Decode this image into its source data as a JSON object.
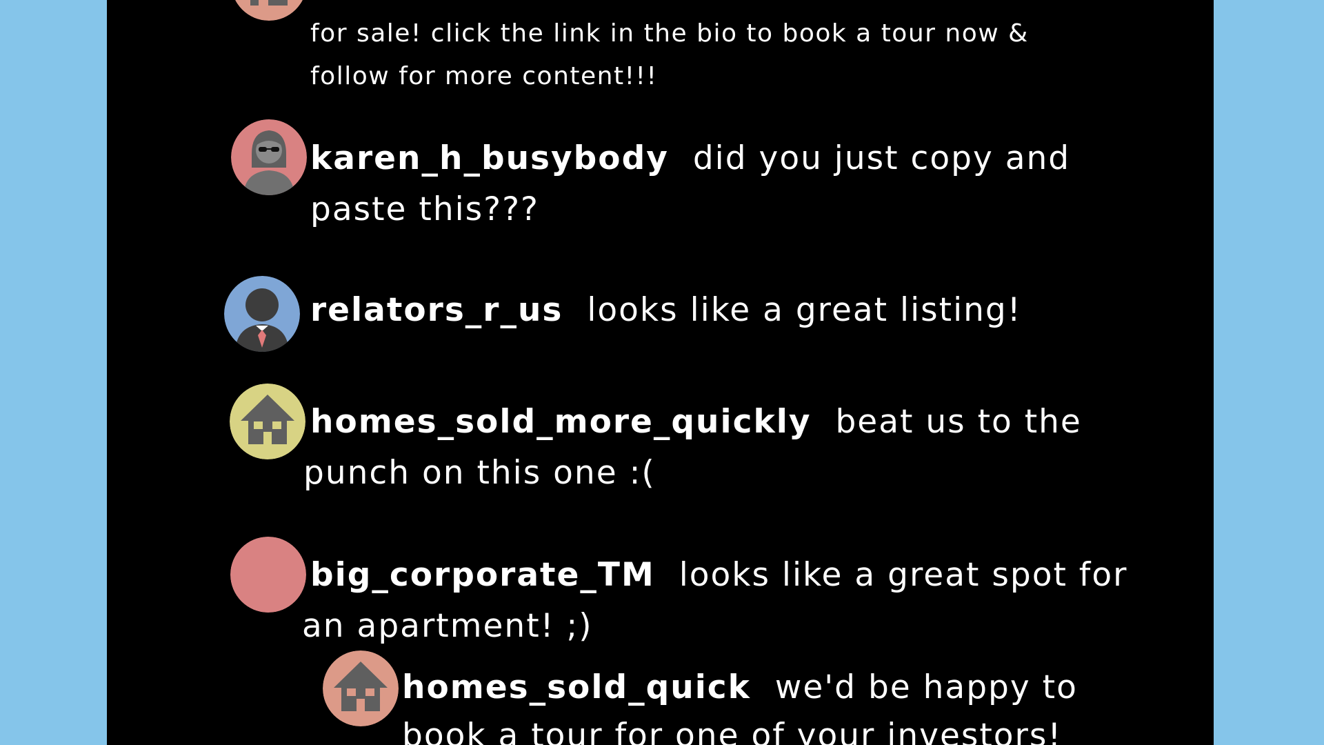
{
  "comments": [
    {
      "user": "",
      "text_line1": "for sale! click the link in the bio to book a tour now &",
      "text_line2": "follow for more content!!!",
      "avatar": "house-avatar",
      "avatar_color": "#dc9a88"
    },
    {
      "user": "karen_h_busybody",
      "text_line1": "did you just copy and",
      "text_line2": "paste this???",
      "avatar": "woman-sunglasses-avatar",
      "avatar_color": "#d98282"
    },
    {
      "user": "relators_r_us",
      "text_line1": "looks like a great listing!",
      "text_line2": "",
      "avatar": "businessman-avatar",
      "avatar_color": "#7fa6d6"
    },
    {
      "user": "homes_sold_more_quickly",
      "text_line1": "beat us to the",
      "text_line2": "punch on this one :(",
      "avatar": "house-avatar",
      "avatar_color": "#d8d384"
    },
    {
      "user": "big_corporate_TM",
      "text_line1": "looks like a great spot for",
      "text_line2": "an apartment! ;)",
      "avatar": "blank-avatar",
      "avatar_color": "#d98282"
    },
    {
      "user": "homes_sold_quick",
      "text_line1": "we'd be happy to",
      "text_line2": "book a tour for one of your investors!",
      "avatar": "house-avatar",
      "avatar_color": "#dc9a88"
    }
  ],
  "colors": {
    "page_background": "#85c5ea",
    "panel_background": "#000000",
    "text": "#ffffff",
    "icon_gray": "#5f5f5f"
  }
}
